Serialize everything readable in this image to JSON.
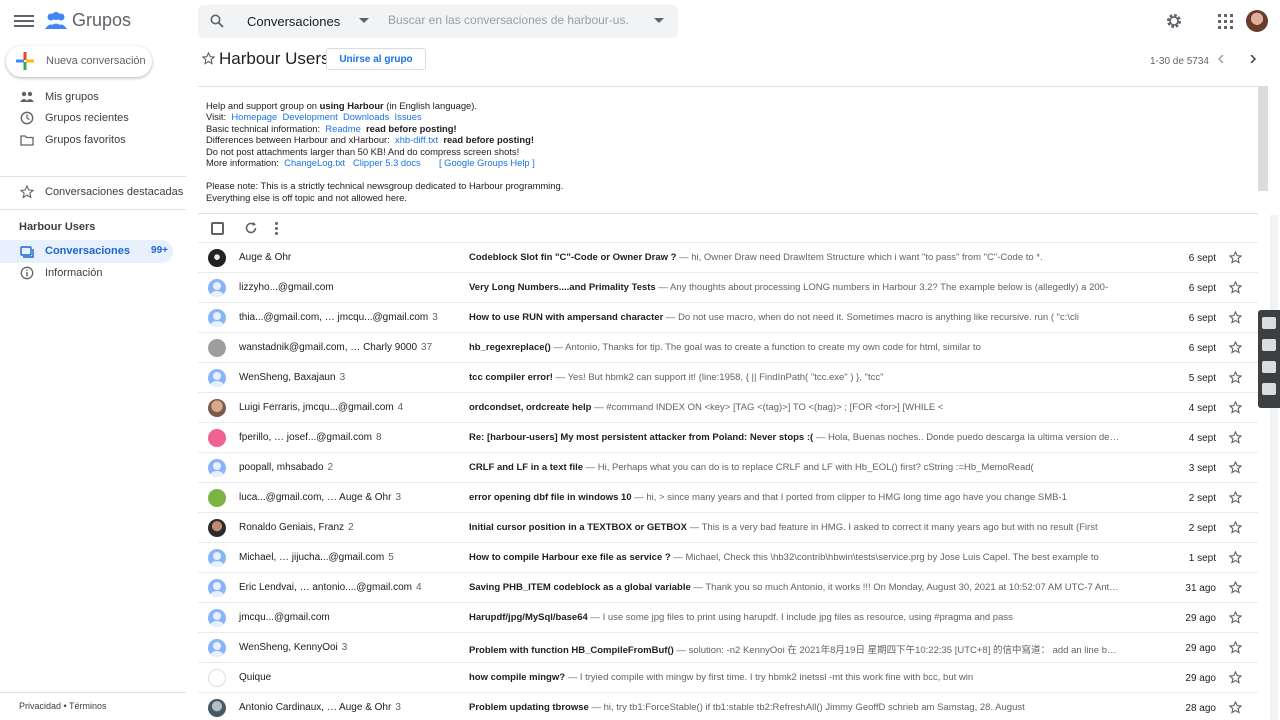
{
  "header": {
    "app_name": "Grupos",
    "search_scope": "Conversaciones",
    "search_placeholder": "Buscar en las conversaciones de harbour-us..."
  },
  "sidebar": {
    "new_conversation": "Nueva conversación",
    "items": [
      {
        "label": "Mis grupos",
        "icon": "groups-icon"
      },
      {
        "label": "Grupos recientes",
        "icon": "clock-icon"
      },
      {
        "label": "Grupos favoritos",
        "icon": "folder-star-icon"
      },
      {
        "label": "Conversaciones destacadas",
        "icon": "star-icon"
      }
    ],
    "group_heading": "Harbour Users",
    "group_items": [
      {
        "label": "Conversaciones",
        "count": "99+",
        "active": true
      },
      {
        "label": "Información"
      }
    ],
    "footer": "Privacidad • Términos"
  },
  "group": {
    "title": "Harbour Users",
    "join_label": "Unirse al grupo",
    "pager": "1-30 de 5734"
  },
  "about": {
    "line1_pre": "Help and support group on ",
    "line1_bold": "using Harbour",
    "line1_post": " (in English language).",
    "visit_label": "Visit:",
    "visit_links": [
      "Homepage",
      "Development",
      "Downloads",
      "Issues"
    ],
    "basic_label": "Basic technical information:",
    "basic_link": "Readme",
    "read_before": "read before posting!",
    "diff_label": "Differences between Harbour and xHarbour:",
    "diff_link": "xhb-diff.txt",
    "attach_text": "Do not post attachments larger than 50 KB! And do compress screen shots!",
    "more_label": "More information:",
    "more_links": [
      "ChangeLog.txt",
      "Clipper 5.3 docs"
    ],
    "google_help": "[ Google Groups Help ]",
    "note1": "Please note: This is a strictly technical newsgroup dedicated to Harbour programming.",
    "note2": "Everything else is off topic and not allowed here."
  },
  "threads": [
    {
      "sender": "Auge & Ohr",
      "count": "",
      "subject": "Codeblock Slot fin \"C\"-Code or Owner Draw ?",
      "snippet": "hi, Owner Draw need DrawItem Structure which i want \"to pass\" from \"C\"-Code to *.",
      "date": "6 sept",
      "avatar": "dark"
    },
    {
      "sender": "lizzyho...@gmail.com",
      "count": "",
      "subject": "Very Long Numbers....and Primality Tests",
      "snippet": "Any thoughts about processing LONG numbers in Harbour 3.2? The example below is (allegedly) a 200-",
      "date": "6 sept",
      "avatar": "default"
    },
    {
      "sender": "thia...@gmail.com, … jmcqu...@gmail.com",
      "count": "3",
      "subject": "How to use RUN with ampersand character",
      "snippet": "Do not use macro, when do not need it. Sometimes macro is anything like recursive. run ( \"c:\\cli",
      "date": "6 sept",
      "avatar": "default"
    },
    {
      "sender": "wanstadnik@gmail.com, … Charly 9000",
      "count": "37",
      "subject": "hb_regexreplace()",
      "snippet": "Antonio, Thanks for tip. The goal was to create a function to create my own code for html, similar to",
      "date": "6 sept",
      "avatar": "gray"
    },
    {
      "sender": "WenSheng, Baxajaun",
      "count": "3",
      "subject": "tcc compiler error!",
      "snippet": "Yes! But hbmk2 can support it! (line:1958, { || FindInPath( \"tcc.exe\" ) }, \"tcc\"",
      "date": "5 sept",
      "avatar": "default"
    },
    {
      "sender": "Luigi Ferraris, jmcqu...@gmail.com",
      "count": "4",
      "subject": "ordcondset, ordcreate help",
      "snippet": "#command INDEX ON <key> [TAG <(tag)>] TO <(bag)> ; [FOR <for>] [WHILE <",
      "date": "4 sept",
      "avatar": "photo"
    },
    {
      "sender": "fperillo, … josef...@gmail.com",
      "count": "8",
      "subject": "Re: [harbour-users] My most persistent attacker from Poland: Never stops :(",
      "snippet": "Hola, Buenas noches.. Donde puedo descarga la ultima version de Harbour",
      "date": "4 sept",
      "avatar": "pink"
    },
    {
      "sender": "poopall, mhsabado",
      "count": "2",
      "subject": "CRLF and LF in a text file",
      "snippet": "Hi, Perhaps what you can do is to replace CRLF and LF with Hb_EOL() first? cString :=Hb_MemoRead(",
      "date": "3 sept",
      "avatar": "default"
    },
    {
      "sender": "luca...@gmail.com, … Auge & Ohr",
      "count": "3",
      "subject": "error opening dbf file in windows 10",
      "snippet": "hi, > since many years and that I ported from clipper to HMG long time ago have you change SMB-1",
      "date": "2 sept",
      "avatar": "green"
    },
    {
      "sender": "Ronaldo Geniais, Franz",
      "count": "2",
      "subject": "Initial cursor position in a TEXTBOX or GETBOX",
      "snippet": "This is a very bad feature in HMG. I asked to correct it many years ago but with no result (First",
      "date": "2 sept",
      "avatar": "dark2"
    },
    {
      "sender": "Michael, … jijucha...@gmail.com",
      "count": "5",
      "subject": "How to compile Harbour exe file as service ?",
      "snippet": "Michael, Check this \\hb32\\contrib\\hbwin\\tests\\service.prg by Jose Luis Capel. The best example to",
      "date": "1 sept",
      "avatar": "default"
    },
    {
      "sender": "Eric Lendvai, … antonio....@gmail.com",
      "count": "4",
      "subject": "Saving PHB_ITEM codeblock as a global variable",
      "snippet": "Thank you so much Antonio, it works !!! On Monday, August 30, 2021 at 10:52:07 AM UTC-7 Antonio",
      "date": "31 ago",
      "avatar": "default"
    },
    {
      "sender": "jmcqu...@gmail.com",
      "count": "",
      "subject": "Harupdf/jpg/MySql/base64",
      "snippet": "I use some jpg files to print using harupdf. I include jpg files as resource, using #pragma and pass",
      "date": "29 ago",
      "avatar": "default"
    },
    {
      "sender": "WenSheng, KennyOoi",
      "count": "3",
      "subject": "Problem with function HB_CompileFromBuf()",
      "snippet": "solution: -n2 KennyOoi 在 2021年8月19日 星期四下午10:22:35 [UTC+8] 的信中寫道： add an line before",
      "date": "29 ago",
      "avatar": "default"
    },
    {
      "sender": "Quique",
      "count": "",
      "subject": "how compile mingw?",
      "snippet": "I tryied compile with mingw by first time. I try hbmk2 inetssl -mt this work fine with bcc, but win",
      "date": "29 ago",
      "avatar": "logo"
    },
    {
      "sender": "Antonio Cardinaux, … Auge & Ohr",
      "count": "3",
      "subject": "Problem updating tbrowse",
      "snippet": "hi, try tb1:ForceStable() if tb1:stable tb2:RefreshAll() Jimmy GeoffD schrieb am Samstag, 28. August",
      "date": "28 ago",
      "avatar": "photo2"
    }
  ],
  "colors": {
    "accent": "#1a73e8",
    "active_bg": "#e8f0fe",
    "text": "#202124",
    "muted": "#5f6368"
  }
}
